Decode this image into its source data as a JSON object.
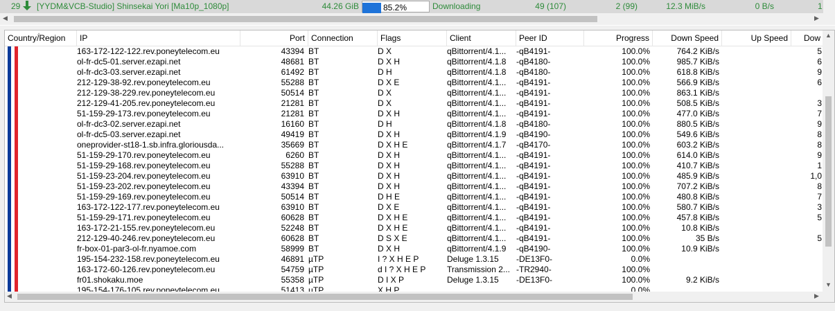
{
  "torrent": {
    "index": "29",
    "name": "[YYDM&VCB-Studio] Shinsekai Yori [Ma10p_1080p]",
    "size": "44.26 GiB",
    "progress_text": "85.2%",
    "progress_fraction": 0.852,
    "status": "Downloading",
    "seeds": "49 (107)",
    "peers": "2 (99)",
    "down_speed": "12.3 MiB/s",
    "up_speed": "0 B/s",
    "last_col": "1",
    "status_color": "#2e8b3a"
  },
  "peer_columns": {
    "country": "Country/Region",
    "ip": "IP",
    "port": "Port",
    "connection": "Connection",
    "flags": "Flags",
    "client": "Client",
    "peer_id": "Peer ID",
    "progress": "Progress",
    "down_speed": "Down Speed",
    "up_speed": "Up Speed",
    "downloaded": "Dow"
  },
  "peers": [
    {
      "ip": "163-172-122-122.rev.poneytelecom.eu",
      "port": "43394",
      "conn": "BT",
      "flags": "D X",
      "client": "qBittorrent/4.1...",
      "peer_id": "-qB4191-",
      "progress": "100.0%",
      "down": "764.2 KiB/s",
      "up": "",
      "dl": "5"
    },
    {
      "ip": "ol-fr-dc5-01.server.ezapi.net",
      "port": "48681",
      "conn": "BT",
      "flags": "D X H",
      "client": "qBittorrent/4.1.8",
      "peer_id": "-qB4180-",
      "progress": "100.0%",
      "down": "985.7 KiB/s",
      "up": "",
      "dl": "6"
    },
    {
      "ip": "ol-fr-dc3-03.server.ezapi.net",
      "port": "61492",
      "conn": "BT",
      "flags": "D H",
      "client": "qBittorrent/4.1.8",
      "peer_id": "-qB4180-",
      "progress": "100.0%",
      "down": "618.8 KiB/s",
      "up": "",
      "dl": "9"
    },
    {
      "ip": "212-129-38-92.rev.poneytelecom.eu",
      "port": "55288",
      "conn": "BT",
      "flags": "D X E",
      "client": "qBittorrent/4.1...",
      "peer_id": "-qB4191-",
      "progress": "100.0%",
      "down": "566.9 KiB/s",
      "up": "",
      "dl": "6"
    },
    {
      "ip": "212-129-38-229.rev.poneytelecom.eu",
      "port": "50514",
      "conn": "BT",
      "flags": "D X",
      "client": "qBittorrent/4.1...",
      "peer_id": "-qB4191-",
      "progress": "100.0%",
      "down": "863.1 KiB/s",
      "up": "",
      "dl": ""
    },
    {
      "ip": "212-129-41-205.rev.poneytelecom.eu",
      "port": "21281",
      "conn": "BT",
      "flags": "D X",
      "client": "qBittorrent/4.1...",
      "peer_id": "-qB4191-",
      "progress": "100.0%",
      "down": "508.5 KiB/s",
      "up": "",
      "dl": "3"
    },
    {
      "ip": "51-159-29-173.rev.poneytelecom.eu",
      "port": "21281",
      "conn": "BT",
      "flags": "D X H",
      "client": "qBittorrent/4.1...",
      "peer_id": "-qB4191-",
      "progress": "100.0%",
      "down": "477.0 KiB/s",
      "up": "",
      "dl": "7"
    },
    {
      "ip": "ol-fr-dc3-02.server.ezapi.net",
      "port": "16160",
      "conn": "BT",
      "flags": "D H",
      "client": "qBittorrent/4.1.8",
      "peer_id": "-qB4180-",
      "progress": "100.0%",
      "down": "880.5 KiB/s",
      "up": "",
      "dl": "9"
    },
    {
      "ip": "ol-fr-dc5-03.server.ezapi.net",
      "port": "49419",
      "conn": "BT",
      "flags": "D X H",
      "client": "qBittorrent/4.1.9",
      "peer_id": "-qB4190-",
      "progress": "100.0%",
      "down": "549.6 KiB/s",
      "up": "",
      "dl": "8"
    },
    {
      "ip": "oneprovider-st18-1.sb.infra.gloriousda...",
      "port": "35669",
      "conn": "BT",
      "flags": "D X H E",
      "client": "qBittorrent/4.1.7",
      "peer_id": "-qB4170-",
      "progress": "100.0%",
      "down": "603.2 KiB/s",
      "up": "",
      "dl": "8"
    },
    {
      "ip": "51-159-29-170.rev.poneytelecom.eu",
      "port": "6260",
      "conn": "BT",
      "flags": "D X H",
      "client": "qBittorrent/4.1...",
      "peer_id": "-qB4191-",
      "progress": "100.0%",
      "down": "614.0 KiB/s",
      "up": "",
      "dl": "9"
    },
    {
      "ip": "51-159-29-168.rev.poneytelecom.eu",
      "port": "55288",
      "conn": "BT",
      "flags": "D X H",
      "client": "qBittorrent/4.1...",
      "peer_id": "-qB4191-",
      "progress": "100.0%",
      "down": "410.7 KiB/s",
      "up": "",
      "dl": "1"
    },
    {
      "ip": "51-159-23-204.rev.poneytelecom.eu",
      "port": "63910",
      "conn": "BT",
      "flags": "D X H",
      "client": "qBittorrent/4.1...",
      "peer_id": "-qB4191-",
      "progress": "100.0%",
      "down": "485.9 KiB/s",
      "up": "",
      "dl": "1,0"
    },
    {
      "ip": "51-159-23-202.rev.poneytelecom.eu",
      "port": "43394",
      "conn": "BT",
      "flags": "D X H",
      "client": "qBittorrent/4.1...",
      "peer_id": "-qB4191-",
      "progress": "100.0%",
      "down": "707.2 KiB/s",
      "up": "",
      "dl": "8"
    },
    {
      "ip": "51-159-29-169.rev.poneytelecom.eu",
      "port": "50514",
      "conn": "BT",
      "flags": "D H E",
      "client": "qBittorrent/4.1...",
      "peer_id": "-qB4191-",
      "progress": "100.0%",
      "down": "480.8 KiB/s",
      "up": "",
      "dl": "7"
    },
    {
      "ip": "163-172-122-177.rev.poneytelecom.eu",
      "port": "63910",
      "conn": "BT",
      "flags": "D X E",
      "client": "qBittorrent/4.1...",
      "peer_id": "-qB4191-",
      "progress": "100.0%",
      "down": "580.7 KiB/s",
      "up": "",
      "dl": "3"
    },
    {
      "ip": "51-159-29-171.rev.poneytelecom.eu",
      "port": "60628",
      "conn": "BT",
      "flags": "D X H E",
      "client": "qBittorrent/4.1...",
      "peer_id": "-qB4191-",
      "progress": "100.0%",
      "down": "457.8 KiB/s",
      "up": "",
      "dl": "5"
    },
    {
      "ip": "163-172-21-155.rev.poneytelecom.eu",
      "port": "52248",
      "conn": "BT",
      "flags": "D X H E",
      "client": "qBittorrent/4.1...",
      "peer_id": "-qB4191-",
      "progress": "100.0%",
      "down": "10.8 KiB/s",
      "up": "",
      "dl": ""
    },
    {
      "ip": "212-129-40-246.rev.poneytelecom.eu",
      "port": "60628",
      "conn": "BT",
      "flags": "D S X E",
      "client": "qBittorrent/4.1...",
      "peer_id": "-qB4191-",
      "progress": "100.0%",
      "down": "35 B/s",
      "up": "",
      "dl": "5"
    },
    {
      "ip": "fr-box-01-par3-ol-fr.nyamoe.com",
      "port": "58999",
      "conn": "BT",
      "flags": "D X H",
      "client": "qBittorrent/4.1.9",
      "peer_id": "-qB4190-",
      "progress": "100.0%",
      "down": "10.9 KiB/s",
      "up": "",
      "dl": ""
    },
    {
      "ip": "195-154-232-158.rev.poneytelecom.eu",
      "port": "46891",
      "conn": "µTP",
      "flags": "I ? X H E P",
      "client": "Deluge 1.3.15",
      "peer_id": "-DE13F0-",
      "progress": "0.0%",
      "down": "",
      "up": "",
      "dl": ""
    },
    {
      "ip": "163-172-60-126.rev.poneytelecom.eu",
      "port": "54759",
      "conn": "µTP",
      "flags": "d I ? X H E P",
      "client": "Transmission 2...",
      "peer_id": "-TR2940-",
      "progress": "100.0%",
      "down": "",
      "up": "",
      "dl": ""
    },
    {
      "ip": "fr01.shokaku.moe",
      "port": "55358",
      "conn": "µTP",
      "flags": "D I X P",
      "client": "Deluge 1.3.15",
      "peer_id": "-DE13F0-",
      "progress": "100.0%",
      "down": "9.2 KiB/s",
      "up": "",
      "dl": ""
    },
    {
      "ip": "195-154-176-105.rev.poneytelecom.eu",
      "port": "51413",
      "conn": "µTP",
      "flags": "X H P",
      "client": "",
      "peer_id": "",
      "progress": "0.0%",
      "down": "",
      "up": "",
      "dl": ""
    }
  ],
  "flag_colors": {
    "blue": "#0a3a9a",
    "white": "#ffffff",
    "red": "#e0242c"
  }
}
